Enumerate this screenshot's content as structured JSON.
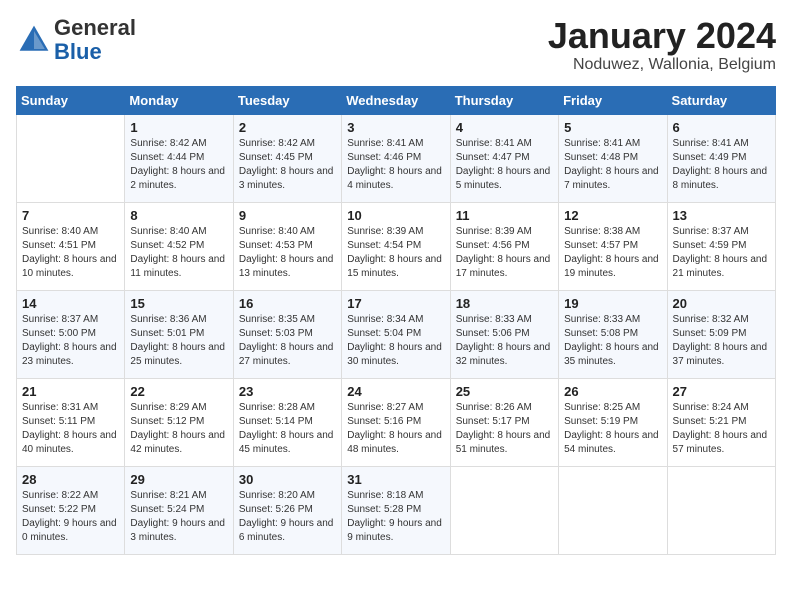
{
  "header": {
    "logo_line1": "General",
    "logo_line2": "Blue",
    "title": "January 2024",
    "subtitle": "Noduwez, Wallonia, Belgium"
  },
  "calendar": {
    "columns": [
      "Sunday",
      "Monday",
      "Tuesday",
      "Wednesday",
      "Thursday",
      "Friday",
      "Saturday"
    ],
    "rows": [
      [
        {
          "day": "",
          "sunrise": "",
          "sunset": "",
          "daylight": ""
        },
        {
          "day": "1",
          "sunrise": "Sunrise: 8:42 AM",
          "sunset": "Sunset: 4:44 PM",
          "daylight": "Daylight: 8 hours and 2 minutes."
        },
        {
          "day": "2",
          "sunrise": "Sunrise: 8:42 AM",
          "sunset": "Sunset: 4:45 PM",
          "daylight": "Daylight: 8 hours and 3 minutes."
        },
        {
          "day": "3",
          "sunrise": "Sunrise: 8:41 AM",
          "sunset": "Sunset: 4:46 PM",
          "daylight": "Daylight: 8 hours and 4 minutes."
        },
        {
          "day": "4",
          "sunrise": "Sunrise: 8:41 AM",
          "sunset": "Sunset: 4:47 PM",
          "daylight": "Daylight: 8 hours and 5 minutes."
        },
        {
          "day": "5",
          "sunrise": "Sunrise: 8:41 AM",
          "sunset": "Sunset: 4:48 PM",
          "daylight": "Daylight: 8 hours and 7 minutes."
        },
        {
          "day": "6",
          "sunrise": "Sunrise: 8:41 AM",
          "sunset": "Sunset: 4:49 PM",
          "daylight": "Daylight: 8 hours and 8 minutes."
        }
      ],
      [
        {
          "day": "7",
          "sunrise": "Sunrise: 8:40 AM",
          "sunset": "Sunset: 4:51 PM",
          "daylight": "Daylight: 8 hours and 10 minutes."
        },
        {
          "day": "8",
          "sunrise": "Sunrise: 8:40 AM",
          "sunset": "Sunset: 4:52 PM",
          "daylight": "Daylight: 8 hours and 11 minutes."
        },
        {
          "day": "9",
          "sunrise": "Sunrise: 8:40 AM",
          "sunset": "Sunset: 4:53 PM",
          "daylight": "Daylight: 8 hours and 13 minutes."
        },
        {
          "day": "10",
          "sunrise": "Sunrise: 8:39 AM",
          "sunset": "Sunset: 4:54 PM",
          "daylight": "Daylight: 8 hours and 15 minutes."
        },
        {
          "day": "11",
          "sunrise": "Sunrise: 8:39 AM",
          "sunset": "Sunset: 4:56 PM",
          "daylight": "Daylight: 8 hours and 17 minutes."
        },
        {
          "day": "12",
          "sunrise": "Sunrise: 8:38 AM",
          "sunset": "Sunset: 4:57 PM",
          "daylight": "Daylight: 8 hours and 19 minutes."
        },
        {
          "day": "13",
          "sunrise": "Sunrise: 8:37 AM",
          "sunset": "Sunset: 4:59 PM",
          "daylight": "Daylight: 8 hours and 21 minutes."
        }
      ],
      [
        {
          "day": "14",
          "sunrise": "Sunrise: 8:37 AM",
          "sunset": "Sunset: 5:00 PM",
          "daylight": "Daylight: 8 hours and 23 minutes."
        },
        {
          "day": "15",
          "sunrise": "Sunrise: 8:36 AM",
          "sunset": "Sunset: 5:01 PM",
          "daylight": "Daylight: 8 hours and 25 minutes."
        },
        {
          "day": "16",
          "sunrise": "Sunrise: 8:35 AM",
          "sunset": "Sunset: 5:03 PM",
          "daylight": "Daylight: 8 hours and 27 minutes."
        },
        {
          "day": "17",
          "sunrise": "Sunrise: 8:34 AM",
          "sunset": "Sunset: 5:04 PM",
          "daylight": "Daylight: 8 hours and 30 minutes."
        },
        {
          "day": "18",
          "sunrise": "Sunrise: 8:33 AM",
          "sunset": "Sunset: 5:06 PM",
          "daylight": "Daylight: 8 hours and 32 minutes."
        },
        {
          "day": "19",
          "sunrise": "Sunrise: 8:33 AM",
          "sunset": "Sunset: 5:08 PM",
          "daylight": "Daylight: 8 hours and 35 minutes."
        },
        {
          "day": "20",
          "sunrise": "Sunrise: 8:32 AM",
          "sunset": "Sunset: 5:09 PM",
          "daylight": "Daylight: 8 hours and 37 minutes."
        }
      ],
      [
        {
          "day": "21",
          "sunrise": "Sunrise: 8:31 AM",
          "sunset": "Sunset: 5:11 PM",
          "daylight": "Daylight: 8 hours and 40 minutes."
        },
        {
          "day": "22",
          "sunrise": "Sunrise: 8:29 AM",
          "sunset": "Sunset: 5:12 PM",
          "daylight": "Daylight: 8 hours and 42 minutes."
        },
        {
          "day": "23",
          "sunrise": "Sunrise: 8:28 AM",
          "sunset": "Sunset: 5:14 PM",
          "daylight": "Daylight: 8 hours and 45 minutes."
        },
        {
          "day": "24",
          "sunrise": "Sunrise: 8:27 AM",
          "sunset": "Sunset: 5:16 PM",
          "daylight": "Daylight: 8 hours and 48 minutes."
        },
        {
          "day": "25",
          "sunrise": "Sunrise: 8:26 AM",
          "sunset": "Sunset: 5:17 PM",
          "daylight": "Daylight: 8 hours and 51 minutes."
        },
        {
          "day": "26",
          "sunrise": "Sunrise: 8:25 AM",
          "sunset": "Sunset: 5:19 PM",
          "daylight": "Daylight: 8 hours and 54 minutes."
        },
        {
          "day": "27",
          "sunrise": "Sunrise: 8:24 AM",
          "sunset": "Sunset: 5:21 PM",
          "daylight": "Daylight: 8 hours and 57 minutes."
        }
      ],
      [
        {
          "day": "28",
          "sunrise": "Sunrise: 8:22 AM",
          "sunset": "Sunset: 5:22 PM",
          "daylight": "Daylight: 9 hours and 0 minutes."
        },
        {
          "day": "29",
          "sunrise": "Sunrise: 8:21 AM",
          "sunset": "Sunset: 5:24 PM",
          "daylight": "Daylight: 9 hours and 3 minutes."
        },
        {
          "day": "30",
          "sunrise": "Sunrise: 8:20 AM",
          "sunset": "Sunset: 5:26 PM",
          "daylight": "Daylight: 9 hours and 6 minutes."
        },
        {
          "day": "31",
          "sunrise": "Sunrise: 8:18 AM",
          "sunset": "Sunset: 5:28 PM",
          "daylight": "Daylight: 9 hours and 9 minutes."
        },
        {
          "day": "",
          "sunrise": "",
          "sunset": "",
          "daylight": ""
        },
        {
          "day": "",
          "sunrise": "",
          "sunset": "",
          "daylight": ""
        },
        {
          "day": "",
          "sunrise": "",
          "sunset": "",
          "daylight": ""
        }
      ]
    ]
  }
}
